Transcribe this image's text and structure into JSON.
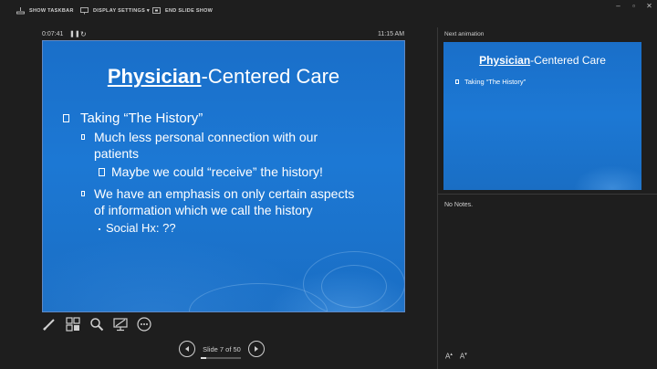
{
  "toolbar": {
    "show_taskbar": "SHOW TASKBAR",
    "display_settings": "DISPLAY SETTINGS ▾",
    "end_slide_show": "END SLIDE SHOW"
  },
  "window_controls": {
    "minimize": "–",
    "restore": "▫",
    "close": "✕"
  },
  "presenter": {
    "elapsed": "0:07:41",
    "clock": "11:15 AM",
    "slide_counter": "Slide 7 of 50",
    "progress_fraction": 0.14
  },
  "slide": {
    "title_underlined": "Physician",
    "title_rest": "-Centered Care",
    "b1": "Taking “The History”",
    "b1_1_line1": "Much less personal connection with our",
    "b1_1_line2": "patients",
    "b1_1_1": "Maybe we could “receive” the history!",
    "b1_2_line1": "We have an emphasis on only certain aspects",
    "b1_2_line2": "of information which we call the history",
    "b1_2_1": "Social Hx: ??"
  },
  "next": {
    "label": "Next animation",
    "title_underlined": "Physician",
    "title_rest": "-Centered Care",
    "bullet": "Taking “The History”"
  },
  "notes": {
    "text": "No Notes."
  },
  "font_buttons": {
    "increase": "A",
    "decrease": "A"
  },
  "colors": {
    "slide_blue": "#1c78d4",
    "background": "#1e1e1e"
  }
}
